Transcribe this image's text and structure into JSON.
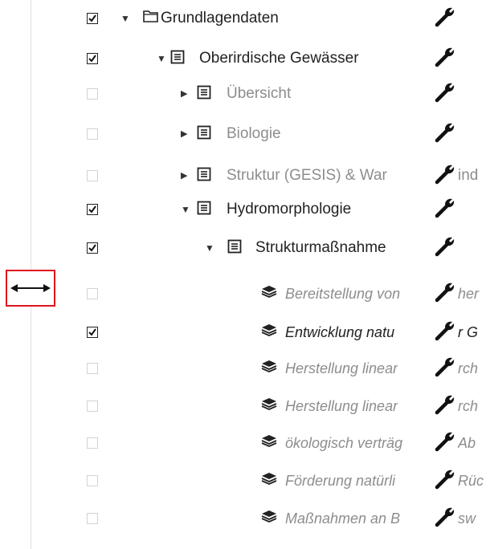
{
  "tree": {
    "rows": [
      {
        "label": "Grundlagendaten",
        "checked": true,
        "expander": "expanded",
        "icon": "folder-icon",
        "style": "black",
        "overflow_text": ""
      },
      {
        "label": "Oberirdische Gewässer",
        "checked": true,
        "expander": "expanded",
        "icon": "document-list-icon",
        "style": "black",
        "overflow_text": ""
      },
      {
        "label": "Übersicht",
        "checked": false,
        "expander": "collapsed",
        "icon": "document-list-icon",
        "style": "muted",
        "overflow_text": ""
      },
      {
        "label": "Biologie",
        "checked": false,
        "expander": "collapsed",
        "icon": "document-list-icon",
        "style": "muted",
        "overflow_text": ""
      },
      {
        "label": "Struktur (GESIS) & War",
        "checked": false,
        "expander": "collapsed",
        "icon": "document-list-icon",
        "style": "muted",
        "overflow_text": "ind"
      },
      {
        "label": "Hydromorphologie",
        "checked": true,
        "expander": "expanded",
        "icon": "document-list-icon",
        "style": "black",
        "overflow_text": ""
      },
      {
        "label": "Strukturmaßnahme",
        "checked": true,
        "expander": "expanded",
        "icon": "document-list-icon",
        "style": "black",
        "overflow_text": ""
      },
      {
        "label": "Bereitstellung von",
        "checked": false,
        "expander": "none",
        "icon": "layers-icon",
        "style": "muted-italic",
        "overflow_text": "her"
      },
      {
        "label": "Entwicklung natu",
        "checked": true,
        "expander": "none",
        "icon": "layers-icon",
        "style": "black-italic",
        "overflow_text": "r G"
      },
      {
        "label": "Herstellung linear",
        "checked": false,
        "expander": "none",
        "icon": "layers-icon",
        "style": "muted-italic",
        "overflow_text": "rch"
      },
      {
        "label": "Herstellung linear",
        "checked": false,
        "expander": "none",
        "icon": "layers-icon",
        "style": "muted-italic",
        "overflow_text": "rch"
      },
      {
        "label": "ökologisch verträg",
        "checked": false,
        "expander": "none",
        "icon": "layers-icon",
        "style": "muted-italic",
        "overflow_text": "Ab"
      },
      {
        "label": "Förderung natürli",
        "checked": false,
        "expander": "none",
        "icon": "layers-icon",
        "style": "muted-italic",
        "overflow_text": "Rüc"
      },
      {
        "label": "Maßnahmen an B",
        "checked": false,
        "expander": "none",
        "icon": "layers-icon",
        "style": "muted-italic",
        "overflow_text": "sw"
      }
    ],
    "row_action_icon": "wrench-icon"
  },
  "resize_handle": {
    "icon": "resize-horizontal-icon",
    "highlight_color": "#e0141e"
  },
  "colors": {
    "text": "#222222",
    "muted": "#8d8d8d",
    "divider": "#dedede"
  }
}
